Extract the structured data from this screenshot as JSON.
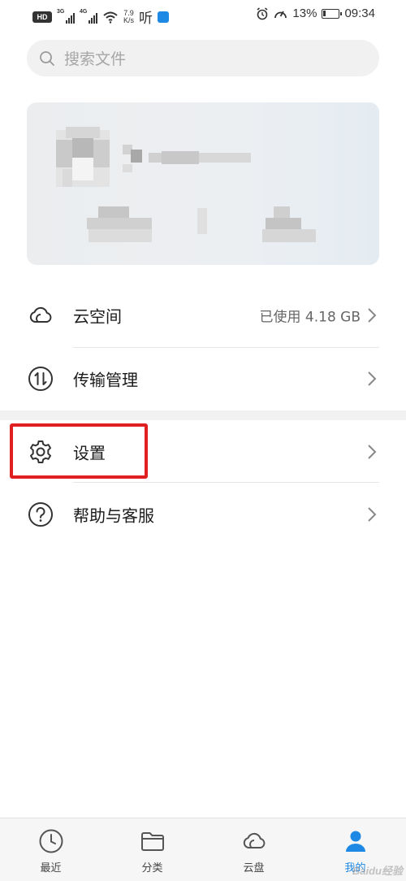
{
  "status_bar": {
    "hd": "HD",
    "sim1_tag": "3G",
    "sim2_tag": "4G",
    "speed_value": "7.9",
    "speed_unit": "K/s",
    "listen": "听",
    "battery_percent": "13%",
    "time": "09:34",
    "icons": [
      "hd-icon",
      "signal-icon",
      "wifi-icon",
      "alarm-icon",
      "speedometer-icon",
      "battery-icon"
    ]
  },
  "search": {
    "placeholder": "搜索文件",
    "icon": "search-icon"
  },
  "profile_card": {
    "obscured": true
  },
  "menu": [
    {
      "icon": "cloud-icon",
      "label": "云空间",
      "value": "已使用 4.18 GB"
    },
    {
      "icon": "transfer-icon",
      "label": "传输管理",
      "value": ""
    },
    {
      "icon": "gear-icon",
      "label": "设置",
      "value": ""
    },
    {
      "icon": "help-icon",
      "label": "帮助与客服",
      "value": ""
    }
  ],
  "bottom_nav": [
    {
      "icon": "clock-icon",
      "label": "最近",
      "active": false
    },
    {
      "icon": "folder-icon",
      "label": "分类",
      "active": false
    },
    {
      "icon": "cloud-icon",
      "label": "云盘",
      "active": false
    },
    {
      "icon": "user-icon",
      "label": "我的",
      "active": true
    }
  ],
  "watermark": "Baidu经验",
  "colors": {
    "accent": "#1e88e5",
    "highlight_box": "#e02020",
    "text_primary": "#1a1a1a",
    "text_secondary": "#666666"
  }
}
